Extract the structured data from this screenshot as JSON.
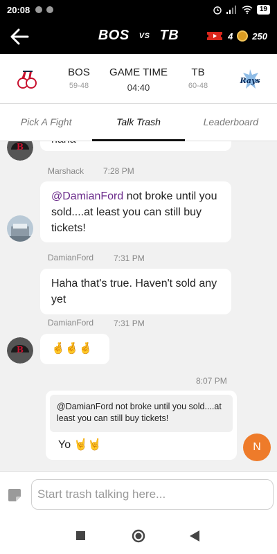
{
  "status_bar": {
    "time": "20:08",
    "battery": "19"
  },
  "header": {
    "home_abbr": "BOS",
    "vs_label": "VS",
    "away_abbr": "TB",
    "tickets_count": "4",
    "coins_count": "250",
    "colors": {
      "background": "#000000",
      "ticket_red": "#d9261c",
      "coin_gold": "#d99b22"
    }
  },
  "scoreboard": {
    "home": {
      "name": "BOS",
      "record": "59-48",
      "logo": "red-sox-logo"
    },
    "game": {
      "label": "GAME TIME",
      "time": "04:40"
    },
    "away": {
      "name": "TB",
      "record": "60-48",
      "logo": "rays-logo"
    }
  },
  "tabs": [
    {
      "label": "Pick A Fight",
      "active": false
    },
    {
      "label": "Talk Trash",
      "active": true
    },
    {
      "label": "Leaderboard",
      "active": false
    }
  ],
  "messages": [
    {
      "text": "haha"
    },
    {
      "user": "Marshack",
      "time": "7:28 PM",
      "mention": "@DamianFord",
      "text": " not broke until you sold....at least you can still buy tickets!",
      "avatar": "stadium-photo-avatar"
    },
    {
      "user": "DamianFord",
      "time": "7:31 PM",
      "text": "Haha that's true.  Haven't sold any yet"
    },
    {
      "user": "DamianFord",
      "time": "7:31 PM",
      "text": "🤞🤞🤞",
      "avatar": "red-sox-cap-avatar"
    },
    {
      "time": "8:07 PM",
      "quote": "@DamianFord not broke until you sold....at least you can still buy tickets!",
      "text": "Yo 🤘🤘",
      "avatar_initial": "N"
    }
  ],
  "composer": {
    "placeholder": "Start trash talking here..."
  },
  "accent_colors": {
    "user_avatar": "#ee7b2a",
    "mention": "#6a2a8a"
  }
}
